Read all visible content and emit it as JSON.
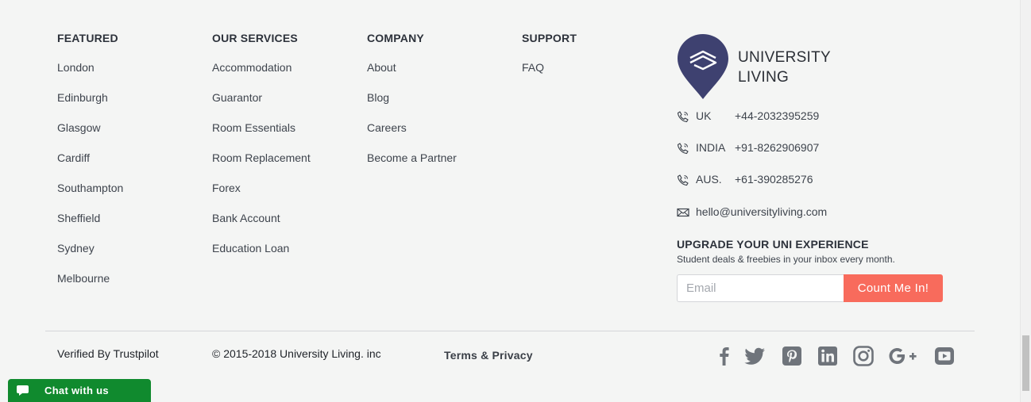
{
  "columns": [
    {
      "heading": "FEATURED",
      "links": [
        "London",
        "Edinburgh",
        "Glasgow",
        "Cardiff",
        "Southampton",
        "Sheffield",
        "Sydney",
        "Melbourne"
      ]
    },
    {
      "heading": "OUR SERVICES",
      "links": [
        "Accommodation",
        "Guarantor",
        "Room Essentials",
        "Room Replacement",
        "Forex",
        "Bank Account",
        "Education Loan"
      ]
    },
    {
      "heading": "COMPANY",
      "links": [
        "About",
        "Blog",
        "Careers",
        "Become a Partner"
      ]
    },
    {
      "heading": "SUPPORT",
      "links": [
        "FAQ"
      ]
    }
  ],
  "brand": {
    "line1": "UNIVERSITY",
    "line2": "LIVING",
    "color": "#3e4170"
  },
  "contacts": {
    "uk": {
      "country": "UK",
      "number": "+44-2032395259"
    },
    "india": {
      "country": "INDIA",
      "number": "+91-8262906907"
    },
    "aus": {
      "country": "AUS.",
      "number": "+61-390285276"
    },
    "email": "hello@universityliving.com"
  },
  "newsletter": {
    "title": "UPGRADE YOUR UNI EXPERIENCE",
    "subtitle": "Student deals & freebies in your inbox every month.",
    "placeholder": "Email",
    "button_label": "Count Me In!",
    "accent": "#f86b5c"
  },
  "bottom": {
    "trustpilot": "Verified By Trustpilot",
    "copyright": "© 2015-2018 University Living. inc",
    "terms": "Terms & Privacy"
  },
  "socials": [
    "facebook-icon",
    "twitter-icon",
    "pinterest-icon",
    "linkedin-icon",
    "instagram-icon",
    "google-plus-icon",
    "youtube-icon"
  ],
  "chat": {
    "label": "Chat with us",
    "color": "#108a2e"
  }
}
